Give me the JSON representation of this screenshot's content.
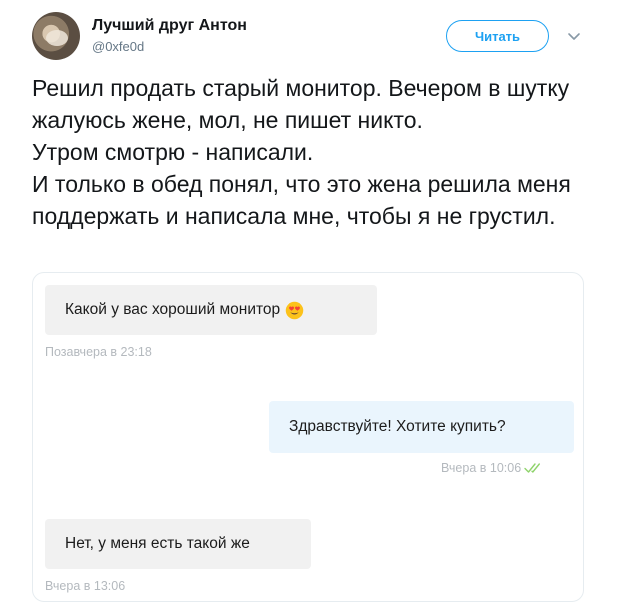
{
  "author": {
    "name": "Лучший друг Антон",
    "handle": "@0xfe0d",
    "avatar_icon": "user-avatar"
  },
  "follow_button": {
    "label": "Читать"
  },
  "menu_icon": "chevron-down-icon",
  "tweet": {
    "text": "Решил продать старый монитор. Вечером в шутку жалуюсь жене, мол, не пишет никто.\nУтром смотрю - написали.\nИ только в обед понял, что это жена решила меня поддержать и написала мне, чтобы я не грустил."
  },
  "chat": {
    "messages": [
      {
        "direction": "in",
        "text": "Какой у вас хороший монитор",
        "emoji": "heart-eyes-emoji",
        "time": "Позавчера в 23:18"
      },
      {
        "direction": "out",
        "text": "Здравствуйте! Хотите купить?",
        "time": "Вчера в 10:06",
        "status_icon": "double-check-icon"
      },
      {
        "direction": "in",
        "text": "Нет, у меня есть такой же",
        "time": "Вчера в 13:06"
      }
    ]
  },
  "colors": {
    "accent": "#1da1f2",
    "incoming_bubble": "#f1f1f1",
    "outgoing_bubble": "#eaf5fd",
    "timestamp": "#b4b9be",
    "read_check": "#8fd36b",
    "emoji_face": "#fcc21b",
    "emoji_heart": "#f44336"
  }
}
